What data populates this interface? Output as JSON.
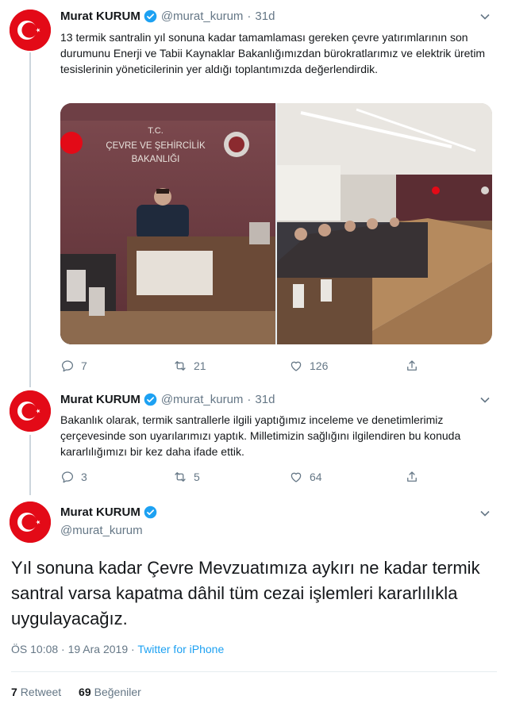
{
  "author": {
    "name": "Murat KURUM",
    "handle": "@murat_kurum"
  },
  "colors": {
    "verified": "#1da1f2",
    "avatar_red": "#e30a17",
    "link": "#1da1f2",
    "muted": "#657786"
  },
  "tweets": [
    {
      "name": "Murat KURUM",
      "handle": "@murat_kurum",
      "sep": "·",
      "time": "31d",
      "text": "13 termik santralin yıl sonuna kadar tamamlaması gereken çevre yatırımlarının son durumunu Enerji ve Tabii Kaynaklar Bakanlığımızdan bürokratlarımız ve elektrik üretim tesislerinin yöneticilerinin yer aldığı toplantımızda değerlendirdik.",
      "media_sign": {
        "line1": "T.C.",
        "line2": "ÇEVRE VE ŞEHİRCİLİK",
        "line3": "BAKANLIĞI"
      },
      "replies": "7",
      "retweets": "21",
      "likes": "126"
    },
    {
      "name": "Murat KURUM",
      "handle": "@murat_kurum",
      "sep": "·",
      "time": "31d",
      "text": "Bakanlık olarak, termik santrallerle ilgili yaptığımız inceleme ve denetimlerimiz çerçevesinde son uyarılarımızı yaptık. Milletimizin sağlığını ilgilendiren bu konuda kararlılığımızı bir kez daha ifade ettik.",
      "replies": "3",
      "retweets": "5",
      "likes": "64"
    }
  ],
  "main_tweet": {
    "name": "Murat KURUM",
    "handle": "@murat_kurum",
    "text": "Yıl sonuna kadar Çevre Mevzuatımıza aykırı ne kadar termik santral varsa kapatma dâhil tüm cezai işlemleri kararlılıkla uygulayacağız.",
    "timestamp": "ÖS 10:08 · 19 Ara 2019",
    "meta_sep": " · ",
    "source": "Twitter for iPhone",
    "retweet_count": "7",
    "retweet_label": "Retweet",
    "like_count": "69",
    "like_label": "Beğeniler"
  },
  "icons": {
    "reply": "reply-icon",
    "retweet": "retweet-icon",
    "like": "heart-icon",
    "share": "share-icon",
    "verified": "verified-badge-icon",
    "caret": "chevron-down-icon"
  }
}
